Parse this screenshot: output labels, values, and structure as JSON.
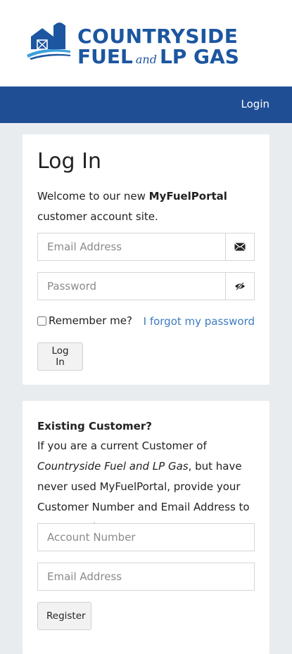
{
  "header": {
    "logo_line1": "COUNTRYSIDE",
    "logo_fuel": "FUEL",
    "logo_and": "and",
    "logo_lp_gas": "LP GAS",
    "brand_color": "#1c56a0"
  },
  "navbar": {
    "login_link": "Login",
    "background": "#1f4e95"
  },
  "login_card": {
    "title": "Log In",
    "welcome_prefix": "Welcome to our new ",
    "welcome_brand": "MyFuelPortal",
    "welcome_suffix": " customer account site.",
    "email_placeholder": "Email Address",
    "email_icon": "envelope-icon",
    "password_placeholder": "Password",
    "password_icon": "eye-slash-icon",
    "remember_label": "Remember me?",
    "forgot_link": "I forgot my password",
    "login_button": "Log In",
    "link_color": "#3c7cc0"
  },
  "register_card": {
    "title": "Existing Customer?",
    "text_prefix": "If you are a current Customer of ",
    "text_company": "Countryside Fuel and LP Gas",
    "text_suffix": ", but have never used MyFuelPortal, provide your Customer Number and Email Address to get started.",
    "account_placeholder": "Account Number",
    "email_placeholder": "Email Address",
    "register_button": "Register"
  }
}
